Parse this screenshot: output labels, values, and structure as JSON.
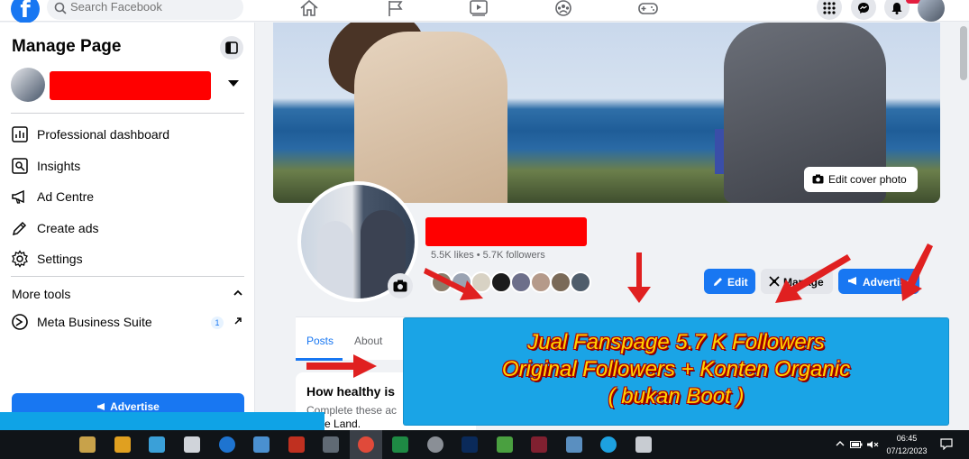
{
  "topbar": {
    "logo": "f",
    "search_placeholder": "Search Facebook",
    "nav_icons": [
      "home-icon",
      "flag-icon",
      "video-icon",
      "groups-icon",
      "gaming-icon"
    ],
    "right_icons": [
      "menu-grid-icon",
      "messenger-icon",
      "bell-icon"
    ]
  },
  "sidebar": {
    "title": "Manage Page",
    "items": [
      {
        "label": "Professional dashboard",
        "icon": "dashboard-icon"
      },
      {
        "label": "Insights",
        "icon": "insights-icon"
      },
      {
        "label": "Ad Centre",
        "icon": "megaphone-icon"
      },
      {
        "label": "Create ads",
        "icon": "pencil-icon"
      },
      {
        "label": "Settings",
        "icon": "gear-icon"
      }
    ],
    "more_tools": "More tools",
    "meta_suite": {
      "label": "Meta Business Suite",
      "badge": "1"
    },
    "advertise": "Advertise"
  },
  "profile": {
    "stats": "5.5K likes • 5.7K followers",
    "edit_cover": "Edit cover photo",
    "buttons": {
      "edit": "Edit",
      "manage": "Manage",
      "advertise": "Advertise"
    }
  },
  "tabs": [
    {
      "label": "Posts"
    },
    {
      "label": "About"
    }
  ],
  "health_card": {
    "title": "How healthy is",
    "subtitle": "Complete these ac",
    "subtitle2": "g the Land."
  },
  "promo": {
    "line1": "Jual Fanspage 5.7 K Followers",
    "line2": "Original Followers + Konten Organic",
    "line3": "( bukan Boot )"
  },
  "tray": {
    "time": "06:45",
    "date": "07/12/2023"
  },
  "colors": {
    "accent": "#1877f2",
    "redact": "#ff0000",
    "promo_bg": "#1aa4e6",
    "promo_text": "#ffd400",
    "arrow": "#e02020"
  }
}
